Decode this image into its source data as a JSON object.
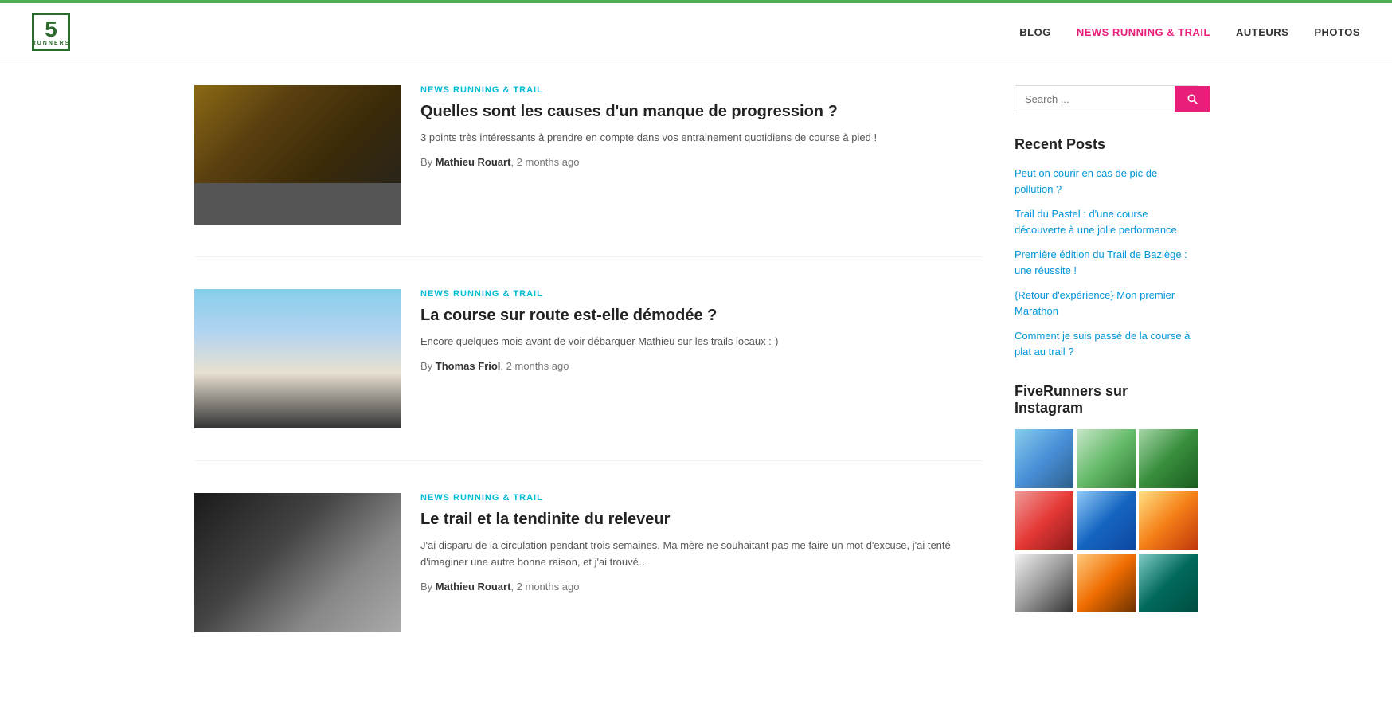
{
  "topbar": {},
  "header": {
    "logo_number": "5",
    "logo_subtext": "RUNNERS",
    "nav": [
      {
        "label": "BLOG",
        "href": "#",
        "active": false
      },
      {
        "label": "NEWS RUNNING & TRAIL",
        "href": "#",
        "active": true
      },
      {
        "label": "AUTEURS",
        "href": "#",
        "active": false
      },
      {
        "label": "PHOTOS",
        "href": "#",
        "active": false
      }
    ]
  },
  "sidebar": {
    "search_placeholder": "Search ...",
    "search_button_label": "Search",
    "recent_posts_title": "Recent Posts",
    "recent_posts": [
      {
        "label": "Peut on courir en cas de pic de pollution ?"
      },
      {
        "label": "Trail du Pastel : d'une course découverte à une jolie performance"
      },
      {
        "label": "Première édition du Trail de Baziège : une réussite !"
      },
      {
        "label": "{Retour d'expérience} Mon premier Marathon"
      },
      {
        "label": "Comment je suis passé de la course à plat au trail ?"
      }
    ],
    "instagram_title": "FiveRunners sur Instagram"
  },
  "articles": [
    {
      "category": "NEWS RUNNING & TRAIL",
      "title": "Quelles sont les causes d'un manque de progression ?",
      "excerpt": "3 points très intéressants à prendre en compte dans vos entrainement quotidiens de course à pied !",
      "author": "Mathieu Rouart",
      "date": "2 months ago",
      "thumb_class": "thumb-running-1"
    },
    {
      "category": "NEWS RUNNING & TRAIL",
      "title": "La course sur route est-elle démodée ?",
      "excerpt": "Encore quelques mois avant de voir débarquer Mathieu sur les trails locaux :-)",
      "author": "Thomas Friol",
      "date": "2 months ago",
      "thumb_class": "thumb-running-2"
    },
    {
      "category": "NEWS RUNNING & TRAIL",
      "title": "Le trail et la tendinite du releveur",
      "excerpt": "J'ai disparu de la circulation pendant trois semaines. Ma mère ne souhaitant pas me faire un mot d'excuse, j'ai tenté d'imaginer une autre bonne raison, et j'ai trouvé…",
      "author": "Mathieu Rouart",
      "date": "2 months ago",
      "thumb_class": "thumb-trail"
    }
  ]
}
